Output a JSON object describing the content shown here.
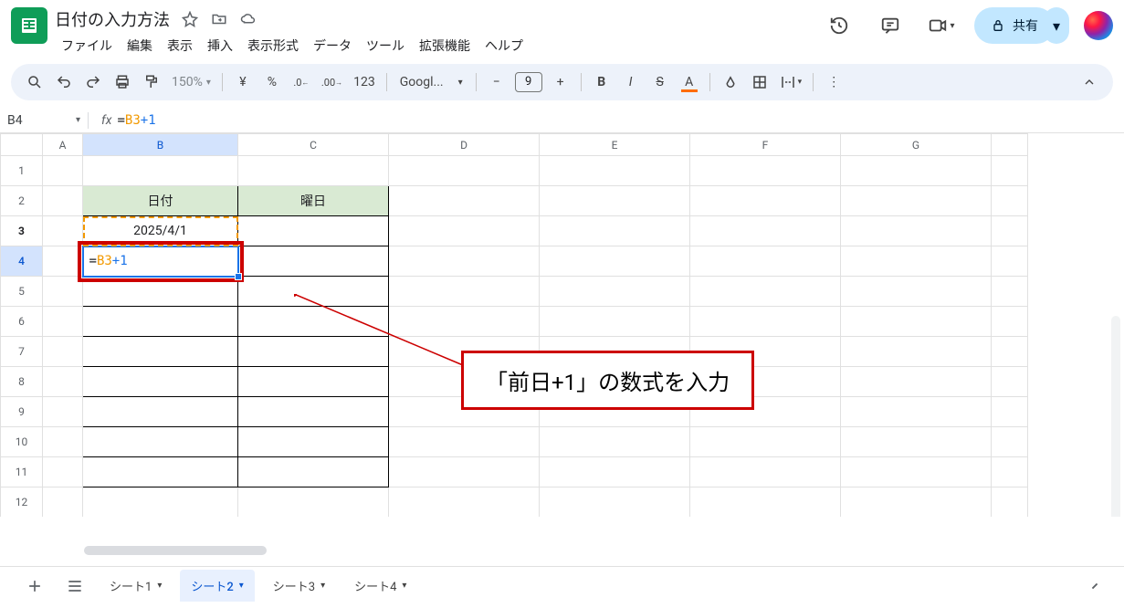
{
  "title": {
    "doc_name": "日付の入力方法",
    "menus": [
      "ファイル",
      "編集",
      "表示",
      "挿入",
      "表示形式",
      "データ",
      "ツール",
      "拡張機能",
      "ヘルプ"
    ],
    "share_label": "共有"
  },
  "toolbar": {
    "zoom": "150%",
    "font": "Googl...",
    "font_size": "9"
  },
  "namebox": {
    "cell": "B4",
    "formula_eq": "=",
    "formula_ref": "B3",
    "formula_rest": "+1"
  },
  "grid": {
    "cols": [
      "A",
      "B",
      "C",
      "D",
      "E",
      "F",
      "G"
    ],
    "rows": [
      "1",
      "2",
      "3",
      "4",
      "5",
      "6",
      "7",
      "8",
      "9",
      "10",
      "11",
      "12"
    ],
    "header_b": "日付",
    "header_c": "曜日",
    "b3": "2025/4/1",
    "b4_eq": "=",
    "b4_ref": "B3",
    "b4_rest": "+1"
  },
  "annotation": "「前日+1」の数式を入力",
  "sheets": {
    "tabs": [
      {
        "label": "シート1",
        "active": false
      },
      {
        "label": "シート2",
        "active": true
      },
      {
        "label": "シート3",
        "active": false
      },
      {
        "label": "シート4",
        "active": false
      }
    ]
  }
}
